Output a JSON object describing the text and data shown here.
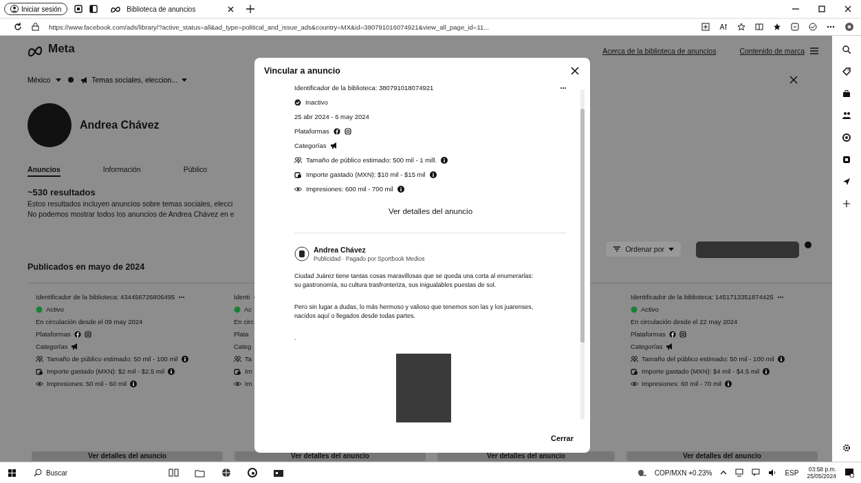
{
  "browser": {
    "profile_button": "Iniciar sesión",
    "tab_title": "Biblioteca de anuncios",
    "url": "https://www.facebook.com/ads/library/?active_status=all&ad_type=political_and_issue_ads&country=MX&id=380791016074921&view_all_page_id=11..."
  },
  "page": {
    "logo": "Meta",
    "header_links": [
      "Acerca de la biblioteca de anuncios",
      "Contenido de marca"
    ],
    "country": "México",
    "topic": "Temas sociales, eleccion...",
    "profile_name": "Andrea Chávez",
    "tabs": [
      {
        "label": "Anuncios",
        "selected": true
      },
      {
        "label": "Información",
        "selected": false
      },
      {
        "label": "Público",
        "selected": false
      }
    ],
    "results": "~530 resultados",
    "notes": [
      "Estos resultados incluyen anuncios sobre temas sociales, elecci",
      "No podemos mostrar todos los anuncios de Andrea Chávez en e"
    ],
    "sort_label": "Ordenar por",
    "section_title": "Publicados en mayo de 2024",
    "cards": [
      {
        "id_label": "Identificador de la biblioteca: 434456726806495",
        "status": "Activo",
        "active": true,
        "dates": "En circulación desde el 09 may 2024",
        "platforms": "Plataformas",
        "categories": "Categorías",
        "icons_visible": true,
        "audience": "Tamaño de público estimado: 50 mil - 100 mil",
        "spend": "Importe gastado (MXN): $2 mil - $2.5 mil",
        "impressions": "Impresiones: 50 mil - 60 mil",
        "button": "Ver detalles del anuncio"
      },
      {
        "id_label": "Identi",
        "status": "Ac",
        "active": true,
        "dates": "En circ",
        "platforms": "Plata",
        "categories": "Categ",
        "icons_visible": false,
        "audience": "Ta",
        "spend": "Im",
        "impressions": "Im",
        "button": "Ver detalles del anuncio"
      },
      {
        "button": "Ver detalles del anuncio"
      },
      {
        "id_label": "Identificador de la biblioteca: 1451713351874425",
        "status": "Activo",
        "active": true,
        "dates": "En circulación desde el 22 may 2024",
        "platforms": "Plataformas",
        "categories": "Categorías",
        "icons_visible": true,
        "audience": "Tamaño del público estimado: 50 mil - 100 mil",
        "spend": "Importe gastado (MXN): $4 mil - $4.5 mil",
        "impressions": "Impresiones: 60 mil - 70 mil",
        "button": "Ver detalles del anuncio"
      }
    ]
  },
  "modal": {
    "title": "Vincular a anuncio",
    "id_label": "Identificador de la biblioteca: 380791018074921",
    "status": "Inactivo",
    "active": false,
    "dates": "25 abr 2024 - 6 may 2024",
    "platforms": "Plataformas",
    "categories": "Categorías",
    "audience": "Tamaño de público estimado: 500 mil - 1 mill.",
    "spend": "Importe gastado (MXN): $10 mil - $15 mil",
    "impressions": "Impresiones: 600 mil - 700 mil",
    "details_link": "Ver detalles del anuncio",
    "advertiser": "Andrea Chávez",
    "sponsor": "Publicidad · Pagado por Sportbook Medios",
    "paragraphs": [
      "Ciudad Juárez tiene tantas cosas maravillosas que se queda una corta al enumerarlas: su gastronomía, su cultura trasfronteriza, sus inigualables puestas de sol.",
      "Pero sin lugar a dudas, lo más hermoso y valioso que tenemos son las y los juarenses, nacidos aquí o llegados desde todas partes.",
      "."
    ],
    "close_button": "Cerrar"
  },
  "taskbar": {
    "search": "Buscar",
    "ticker": "COP/MXN +0.23%",
    "language": "ESP",
    "time": "03:58 p.m.",
    "date": "25/05/2024"
  }
}
